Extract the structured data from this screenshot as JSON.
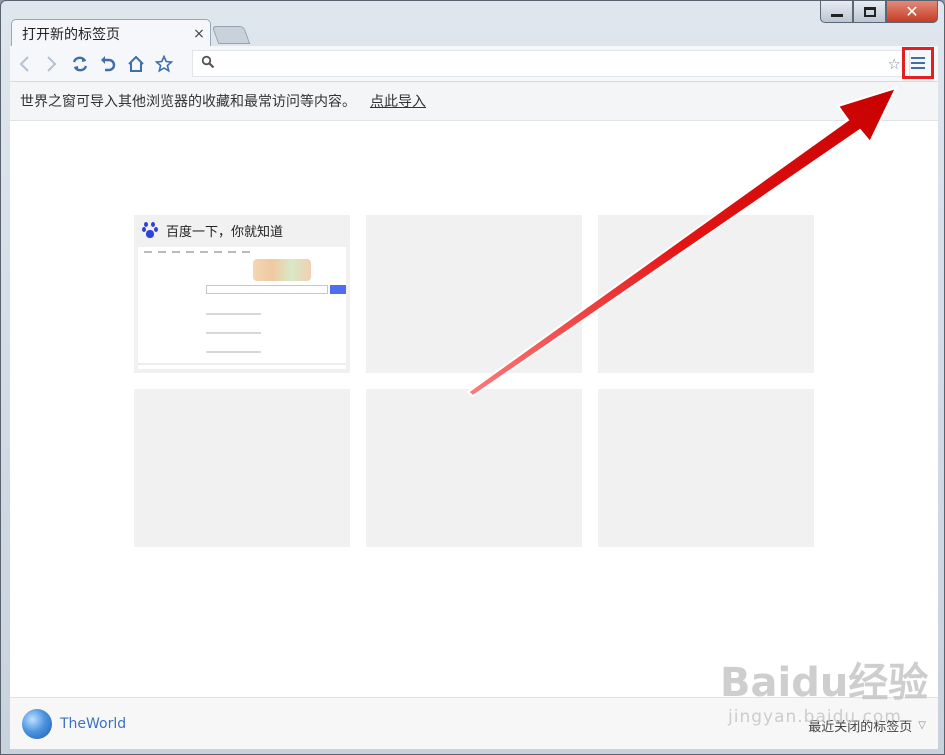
{
  "window": {
    "tab_title": "打开新的标签页",
    "tab_close": "×"
  },
  "toolbar": {
    "address_value": "",
    "address_placeholder": ""
  },
  "infobar": {
    "message": "世界之窗可导入其他浏览器的收藏和最常访问等内容。",
    "link": "点此导入"
  },
  "speed_dial": {
    "tiles": [
      {
        "title": "百度一下，你就知道",
        "has_preview": true
      },
      {
        "title": "",
        "has_preview": false
      },
      {
        "title": "",
        "has_preview": false
      },
      {
        "title": "",
        "has_preview": false
      },
      {
        "title": "",
        "has_preview": false
      },
      {
        "title": "",
        "has_preview": false
      }
    ]
  },
  "statusbar": {
    "brand": "TheWorld",
    "recently_closed": "最近关闭的标签页"
  },
  "watermark": {
    "text": "Baidu经验",
    "sub": "jingyan.baidu.com"
  },
  "colors": {
    "accent": "#3f6ea8",
    "highlight_red": "#e31f1f",
    "baidu_blue": "#2e44d8"
  },
  "icons": [
    "back-icon",
    "forward-icon",
    "refresh-icon",
    "undo-icon",
    "home-icon",
    "star-icon",
    "search-icon",
    "menu-icon",
    "globe-icon",
    "chevron-down-icon"
  ]
}
